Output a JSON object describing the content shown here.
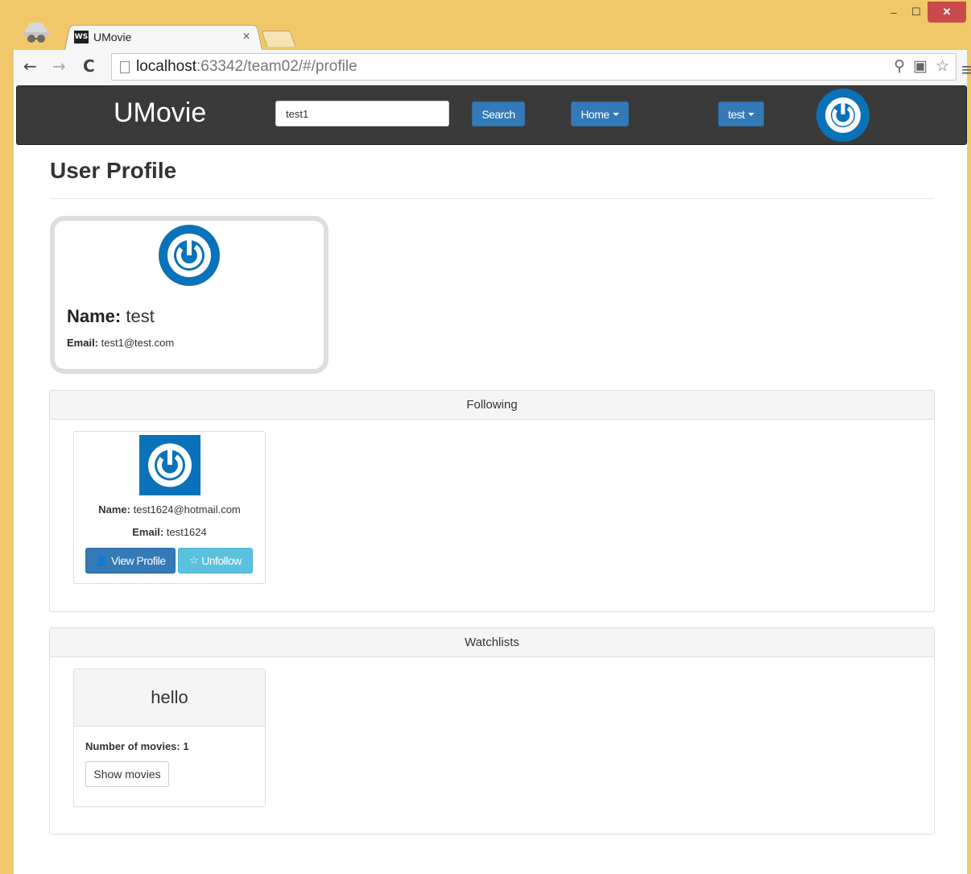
{
  "browser": {
    "tab_title": "UMovie",
    "tab_close": "×",
    "url_host": "localhost",
    "url_path": ":63342/team02/#/profile",
    "minimize": "–",
    "maximize": "☐",
    "close": "✕"
  },
  "navbar": {
    "brand": "UMovie",
    "search_value": "test1",
    "search_button": "Search",
    "home_button": "Home",
    "user_button": "test"
  },
  "page": {
    "title": "User Profile"
  },
  "profile": {
    "name_label": "Name:",
    "name_value": "test",
    "email_label": "Email:",
    "email_value": "test1@test.com"
  },
  "following": {
    "heading": "Following",
    "items": [
      {
        "name_label": "Name:",
        "name_value": "test1624@hotmail.com",
        "email_label": "Email:",
        "email_value": "test1624",
        "view_button": "View Profile",
        "unfollow_button": "Unfollow"
      }
    ]
  },
  "watchlists": {
    "heading": "Watchlists",
    "items": [
      {
        "title": "hello",
        "count_label": "Number of movies:",
        "count_value": "1",
        "show_button": "Show movies"
      }
    ]
  },
  "colors": {
    "primary": "#337ab7",
    "info": "#5bc0de",
    "navbar": "#3a3a3a",
    "avatar_blue": "#0a72b8",
    "chrome": "#f0c769"
  }
}
